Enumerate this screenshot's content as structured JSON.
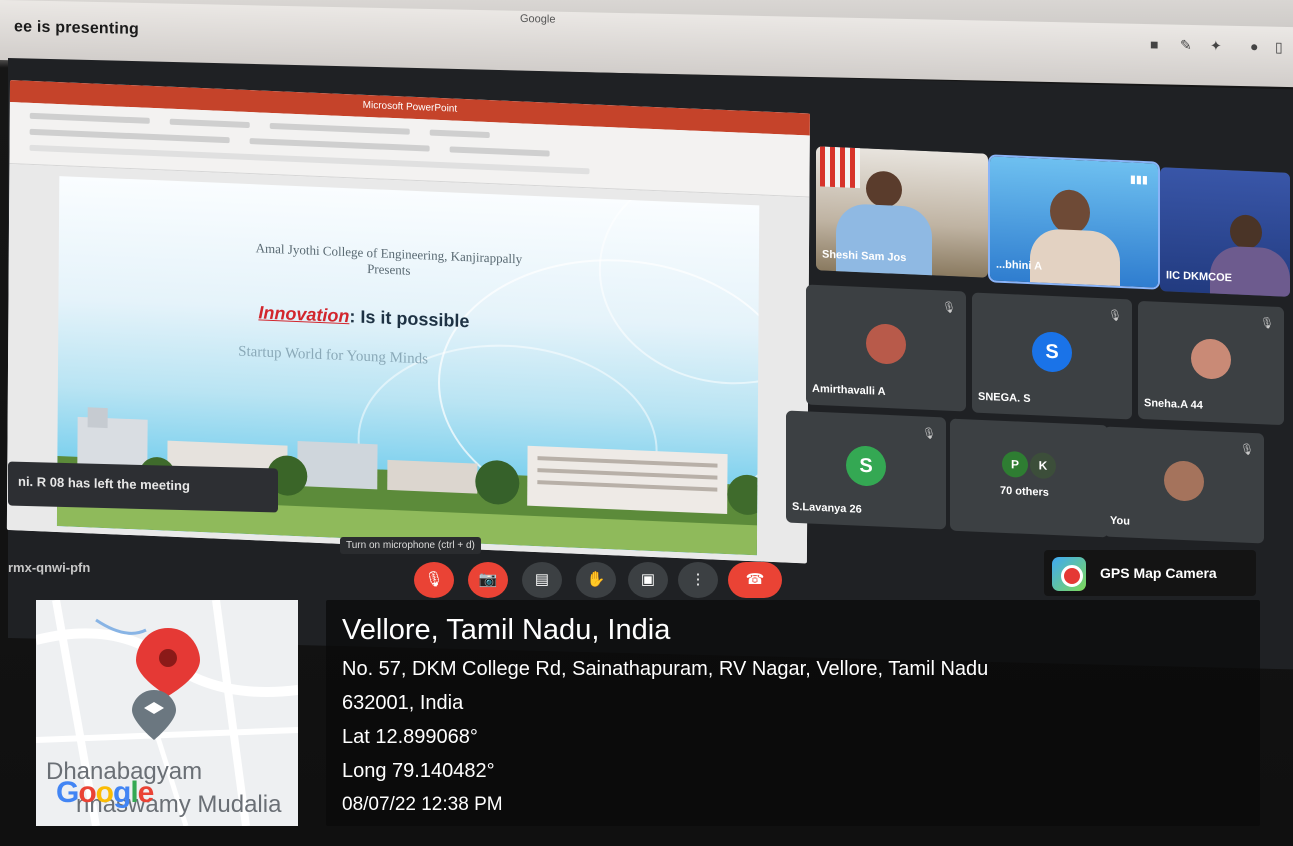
{
  "browser": {
    "presenting_label": "ee is presenting",
    "tab_hint": "Google"
  },
  "meet": {
    "meeting_code": "rmx-qnwi-pfn",
    "tooltip": "Turn on microphone (ctrl + d)",
    "toast": "ni. R 08 has left the meeting",
    "controls": [
      {
        "name": "microphone",
        "icon": "mic-off-icon",
        "glyph": "🎙"
      },
      {
        "name": "camera",
        "icon": "camera-off-icon",
        "glyph": "📷"
      },
      {
        "name": "captions",
        "icon": "captions-icon",
        "glyph": "▤"
      },
      {
        "name": "raise-hand",
        "icon": "hand-icon",
        "glyph": "✋"
      },
      {
        "name": "present",
        "icon": "present-icon",
        "glyph": "▣"
      },
      {
        "name": "more",
        "icon": "more-vert-icon",
        "glyph": "⋮"
      },
      {
        "name": "leave",
        "icon": "end-call-icon",
        "glyph": "☎"
      }
    ],
    "participants": [
      {
        "label": "Sheshi Sam Jos",
        "kind": "video",
        "color": "#8a7a60"
      },
      {
        "label": "...bhini A",
        "kind": "video",
        "color": "#3b8fd8"
      },
      {
        "label": "IIC DKMCOE",
        "kind": "video",
        "color": "#3a62b0"
      },
      {
        "label": "Amirthavalli A",
        "kind": "photo",
        "color": "#b85a4a"
      },
      {
        "label": "SNEGA. S",
        "kind": "letter",
        "letter": "S",
        "color": "#1a73e8"
      },
      {
        "label": "Sneha.A 44",
        "kind": "photo",
        "color": "#c98a76"
      },
      {
        "label": "S.Lavanya 26",
        "kind": "letter",
        "letter": "S",
        "color": "#34a853"
      },
      {
        "label": "70 others",
        "kind": "group",
        "letters": [
          "P",
          "K"
        ],
        "color": "#2e7d32"
      },
      {
        "label": "You",
        "kind": "photo",
        "color": "#a5735c"
      }
    ]
  },
  "presentation": {
    "titlebar": "Microsoft PowerPoint",
    "college": "Amal Jyothi College of Engineering, Kanjirappally",
    "presents": "Presents",
    "innovation": "Innovation",
    "question": ": Is it possible",
    "subtitle": "Startup World for Young Minds"
  },
  "gps": {
    "app_name": "GPS Map Camera",
    "location_title": "Vellore, Tamil Nadu, India",
    "address_line1": "No. 57, DKM College Rd, Sainathapuram, RV Nagar, Vellore, Tamil Nadu",
    "address_line2": "632001, India",
    "lat": "Lat 12.899068°",
    "long": "Long 79.140482°",
    "datetime": "08/07/22 12:38 PM",
    "map_place_1": "Dhanabagyam",
    "map_place_2": "nnaswamy Mudalia",
    "map_brand": "Google"
  },
  "colors": {
    "meet_bg": "#1f2124",
    "tile_bg": "#3c4043",
    "danger": "#ea4335",
    "ppt_red": "#c5432a"
  }
}
